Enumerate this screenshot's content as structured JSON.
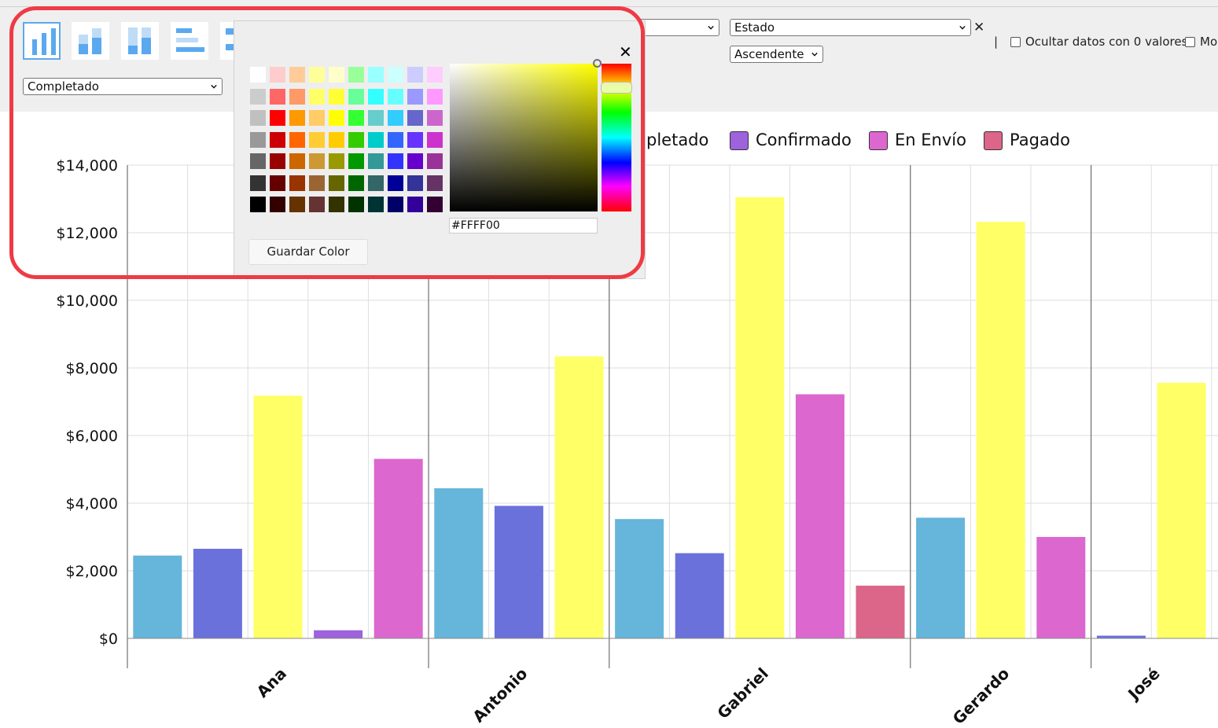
{
  "toolbar": {
    "chart_types": [
      {
        "name": "vertical-bar-chart-icon",
        "selected": true
      },
      {
        "name": "vertical-stacked-bar-chart-icon",
        "selected": false
      },
      {
        "name": "vertical-stacked-percent-chart-icon",
        "selected": false
      },
      {
        "name": "horizontal-bar-chart-icon",
        "selected": false
      },
      {
        "name": "horizontal-stacked-bar-chart-icon",
        "selected": false
      }
    ],
    "series_select": "Completado",
    "sort_field_select": "Estado",
    "sort_order_select": "Ascendente",
    "clear_sort": "✕",
    "separator": "|",
    "hide_zero_label": "Ocultar datos con 0 valores",
    "cut_label": "Mo"
  },
  "color_picker": {
    "hex_value": "#FFFF00",
    "save_label": "Guardar Color",
    "close_label": "✕",
    "swatches": [
      [
        "#ffffff",
        "#ffcccc",
        "#ffcc99",
        "#ffff99",
        "#ffffcc",
        "#99ff99",
        "#99ffff",
        "#ccffff",
        "#ccccff",
        "#ffccff"
      ],
      [
        "#cccccc",
        "#ff6666",
        "#ff9966",
        "#ffff66",
        "#ffff33",
        "#66ff99",
        "#33ffff",
        "#66ffff",
        "#9999ff",
        "#ff99ff"
      ],
      [
        "#c0c0c0",
        "#ff0000",
        "#ff9900",
        "#ffcc66",
        "#ffff00",
        "#33ff33",
        "#66cccc",
        "#33ccff",
        "#6666cc",
        "#cc66cc"
      ],
      [
        "#999999",
        "#cc0000",
        "#ff6600",
        "#ffcc33",
        "#ffcc00",
        "#33cc00",
        "#00cccc",
        "#3366ff",
        "#6633ff",
        "#cc33cc"
      ],
      [
        "#666666",
        "#990000",
        "#cc6600",
        "#cc9933",
        "#999900",
        "#009900",
        "#339999",
        "#3333ff",
        "#6600cc",
        "#993399"
      ],
      [
        "#333333",
        "#660000",
        "#993300",
        "#996633",
        "#666600",
        "#006600",
        "#336666",
        "#000099",
        "#333399",
        "#663366"
      ],
      [
        "#000000",
        "#330000",
        "#663300",
        "#663333",
        "#333300",
        "#003300",
        "#003333",
        "#000066",
        "#330099",
        "#330033"
      ]
    ]
  },
  "chart_data": {
    "type": "bar",
    "categories": [
      "Ana",
      "Antonio",
      "Gabriel",
      "Gerardo",
      "José"
    ],
    "series": [
      {
        "name": "Completado",
        "color": "#ffff66"
      },
      {
        "name": "Confirmado",
        "color": "#9d62dc"
      },
      {
        "name": "En Envío",
        "color": "#dc67cf"
      },
      {
        "name": "Pagado",
        "color": "#db6689"
      }
    ],
    "legend_visible": [
      {
        "label": "pletado",
        "color": null
      },
      {
        "label": "Confirmado",
        "color": "#9d62dc"
      },
      {
        "label": "En Envío",
        "color": "#dc67cf"
      },
      {
        "label": "Pagado",
        "color": "#db6689"
      }
    ],
    "groups": [
      {
        "category": "Ana",
        "bars": [
          {
            "color": "#66b5da",
            "value": 2450
          },
          {
            "color": "#6a71db",
            "value": 2650
          },
          {
            "color": "#ffff66",
            "value": 7180
          },
          {
            "color": "#9d62dc",
            "value": 240
          },
          {
            "color": "#dc67cf",
            "value": 5310
          }
        ]
      },
      {
        "category": "Antonio",
        "bars": [
          {
            "color": "#66b5da",
            "value": 4440
          },
          {
            "color": "#6a71db",
            "value": 3920
          },
          {
            "color": "#ffff66",
            "value": 8340
          }
        ]
      },
      {
        "category": "Gabriel",
        "bars": [
          {
            "color": "#66b5da",
            "value": 3530
          },
          {
            "color": "#6a71db",
            "value": 2520
          },
          {
            "color": "#ffff66",
            "value": 13050
          },
          {
            "color": "#dc67cf",
            "value": 7220
          },
          {
            "color": "#db6689",
            "value": 1560
          }
        ]
      },
      {
        "category": "Gerardo",
        "bars": [
          {
            "color": "#66b5da",
            "value": 3570
          },
          {
            "color": "#ffff66",
            "value": 12320
          },
          {
            "color": "#dc67cf",
            "value": 3000
          }
        ]
      },
      {
        "category": "José",
        "bars": [
          {
            "color": "#6a71db",
            "value": 80
          },
          {
            "color": "#ffff66",
            "value": 7560
          }
        ]
      }
    ],
    "yticks": [
      "$0",
      "$2,000",
      "$4,000",
      "$6,000",
      "$8,000",
      "$10,000",
      "$12,000",
      "$14,000"
    ],
    "ylim": [
      0,
      14000
    ],
    "grid": true,
    "xlabel": "",
    "ylabel": ""
  }
}
